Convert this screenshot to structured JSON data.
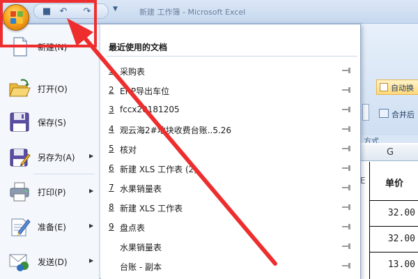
{
  "titlebar": {
    "title": "新建 工作簿 - Microsoft Excel",
    "qat_icons": [
      "save-icon",
      "undo-icon",
      "redo-icon",
      "customize-icon"
    ]
  },
  "ribbon": {
    "auto_button": "自动换",
    "merge_button": "合并后",
    "format_group": "方式"
  },
  "sheet": {
    "column_g": "G",
    "header_cell": "单价",
    "side_char": "E",
    "values": [
      "32.00",
      "32.00",
      "13.00"
    ]
  },
  "menu": {
    "items": [
      {
        "label": "新建(N)",
        "icon": "new-document-icon",
        "has_submenu": false
      },
      {
        "label": "打开(O)",
        "icon": "open-folder-icon",
        "has_submenu": false
      },
      {
        "label": "保存(S)",
        "icon": "save-disk-icon",
        "has_submenu": false
      },
      {
        "label": "另存为(A)",
        "icon": "save-as-icon",
        "has_submenu": true
      },
      {
        "label": "打印(P)",
        "icon": "printer-icon",
        "has_submenu": true
      },
      {
        "label": "准备(E)",
        "icon": "prepare-icon",
        "has_submenu": true
      },
      {
        "label": "发送(D)",
        "icon": "send-icon",
        "has_submenu": true
      }
    ],
    "recent_title": "最近使用的文档",
    "recent_docs": [
      {
        "num": "1",
        "name": "采购表"
      },
      {
        "num": "2",
        "name": "ERP导出车位"
      },
      {
        "num": "3",
        "name": "fccx20181205"
      },
      {
        "num": "4",
        "name": "观云海2#地块收费台账..5.26"
      },
      {
        "num": "5",
        "name": "核对"
      },
      {
        "num": "6",
        "name": "新建 XLS 工作表 (2)"
      },
      {
        "num": "7",
        "name": "水果销量表"
      },
      {
        "num": "8",
        "name": "新建 XLS 工作表"
      },
      {
        "num": "9",
        "name": "盘点表"
      },
      {
        "num": "",
        "name": "水果销量表"
      },
      {
        "num": "",
        "name": "台账 - 副本"
      }
    ]
  },
  "colors": {
    "annotation": "#ee2e2e",
    "office_orange": "#f8a51c"
  }
}
